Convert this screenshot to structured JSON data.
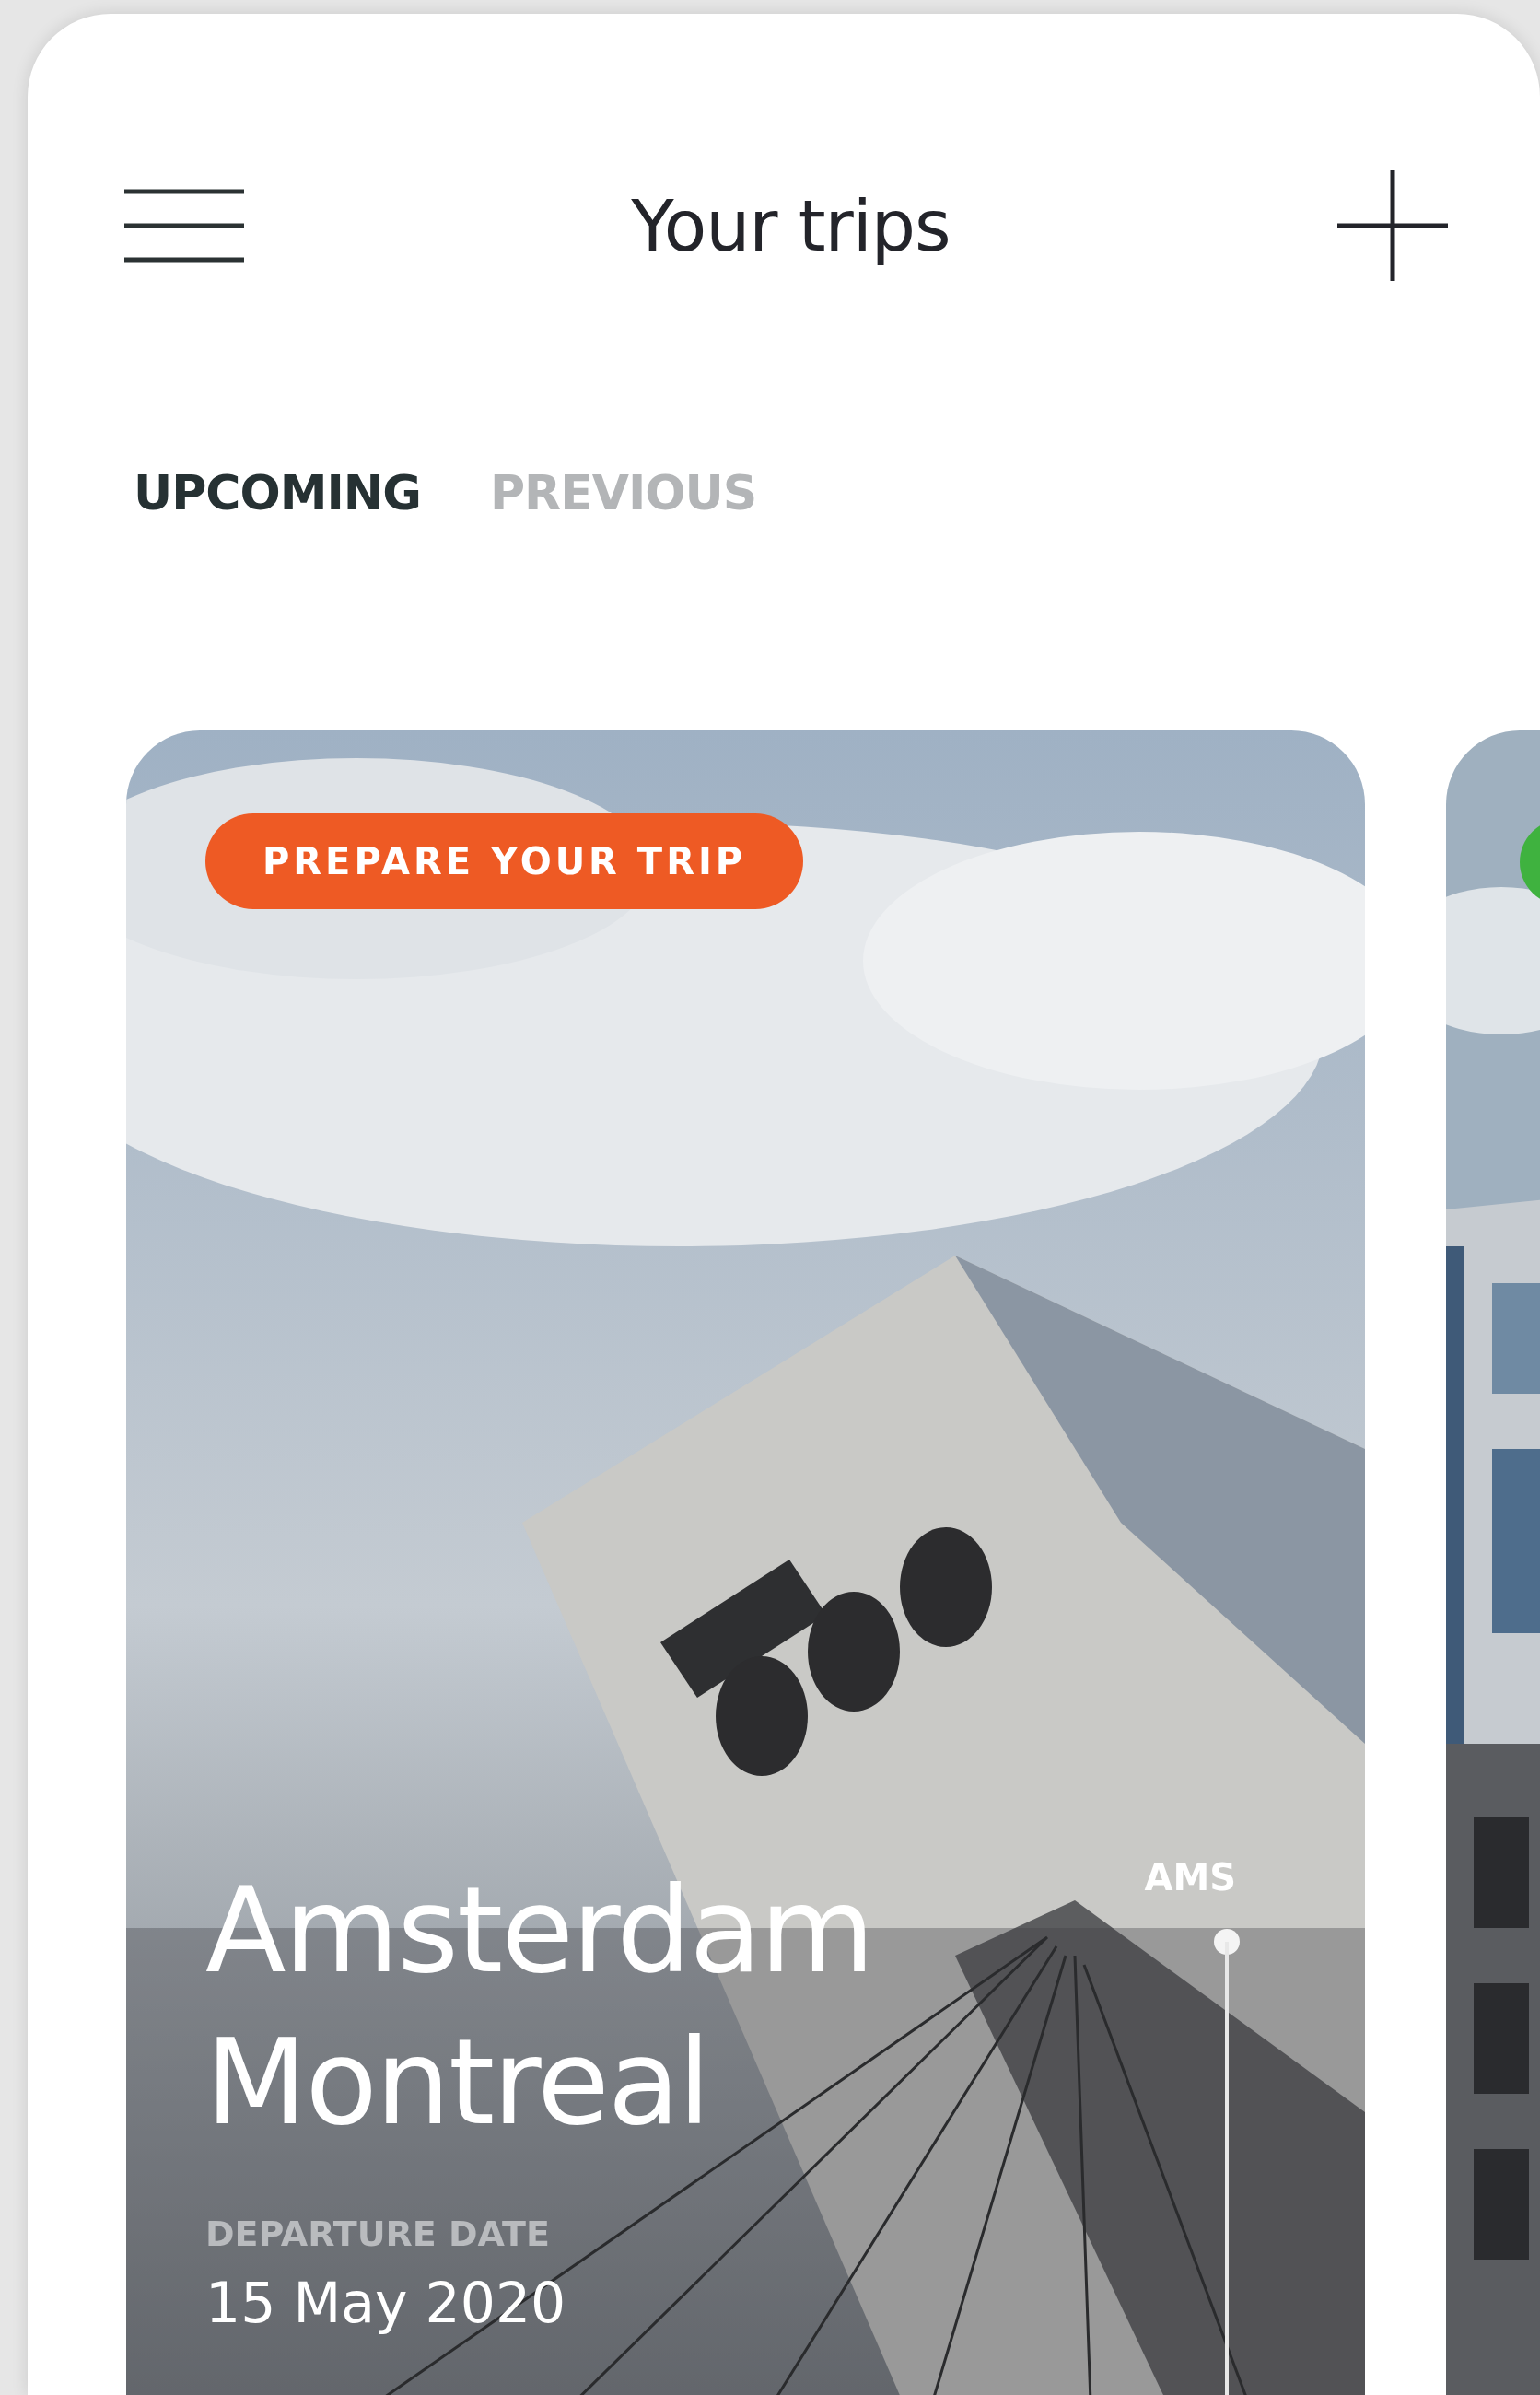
{
  "header": {
    "title": "Your trips"
  },
  "tabs": [
    {
      "label": "UPCOMING",
      "selected": true
    },
    {
      "label": "PREVIOUS",
      "selected": false
    }
  ],
  "trips": [
    {
      "badge": "PREPARE YOUR TRIP",
      "color": "#ee5a24",
      "cities": [
        "Amsterdam",
        "Montreal"
      ],
      "date_label": "DEPARTURE DATE",
      "date": "15 May 2020",
      "origin_code": "AMS"
    },
    {
      "color": "#3fb23f"
    }
  ]
}
